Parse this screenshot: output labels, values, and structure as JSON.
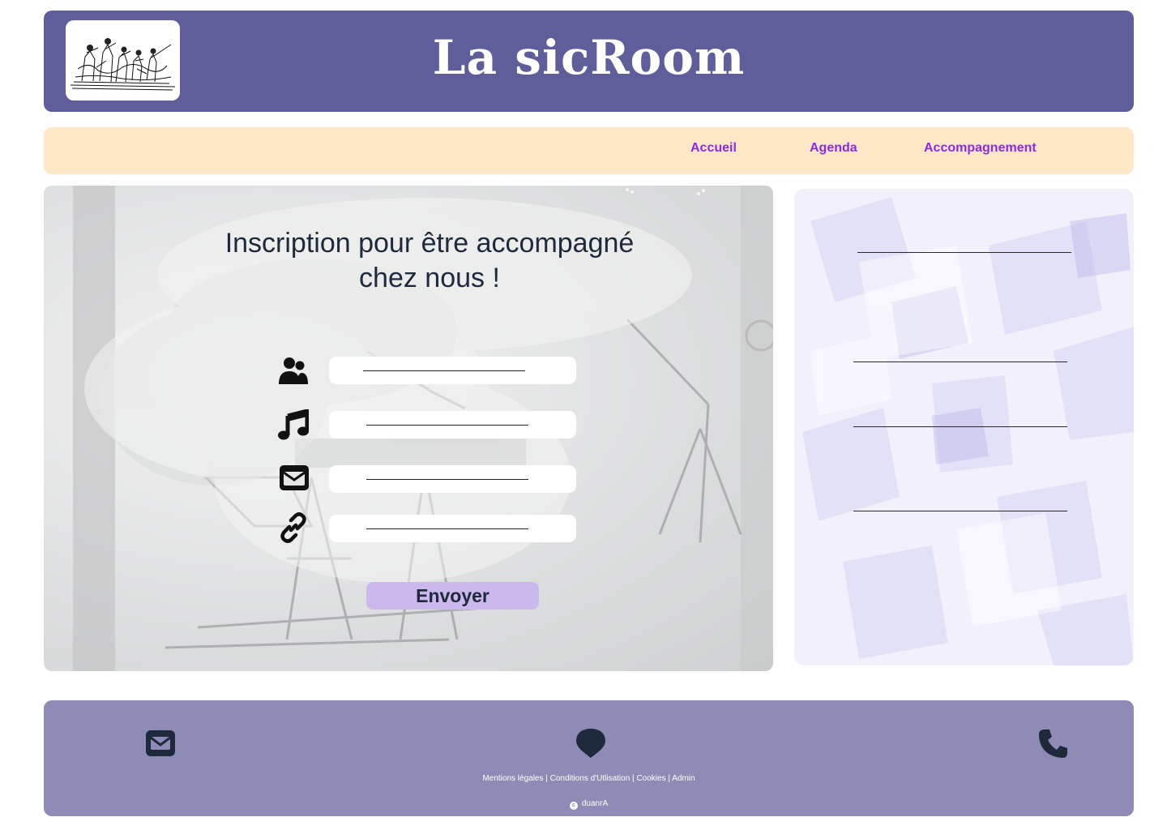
{
  "header": {
    "title": "La sicRoom",
    "logo_alt": "sketch of musicians"
  },
  "nav": {
    "items": [
      {
        "label": "Accueil"
      },
      {
        "label": "Agenda"
      },
      {
        "label": "Accompagnement"
      }
    ]
  },
  "form": {
    "title": "Inscription pour être accompagné chez nous !",
    "fields": [
      {
        "icon": "users-icon",
        "value": ""
      },
      {
        "icon": "music-note-icon",
        "value": ""
      },
      {
        "icon": "envelope-icon",
        "value": ""
      },
      {
        "icon": "link-icon",
        "value": ""
      }
    ],
    "submit_label": "Envoyer"
  },
  "side_panel": {
    "lines": 4
  },
  "footer": {
    "icons": [
      "envelope-icon",
      "map-pin-icon",
      "phone-icon"
    ],
    "legal": {
      "mentions": "Mentions légales",
      "conditions": "Conditions d'Utlisation",
      "cookies": "Cookies",
      "admin": "Admin",
      "separator": " | "
    },
    "copyright_symbol": "c",
    "copyright_name": "duanrA"
  },
  "colors": {
    "header_bg": "#5f5e9a",
    "nav_bg": "#ffe7c7",
    "nav_link": "#8a2be2",
    "footer_bg": "#8e8cb6",
    "button_bg": "#cbb8ec",
    "text_dark": "#1e2a3c"
  }
}
